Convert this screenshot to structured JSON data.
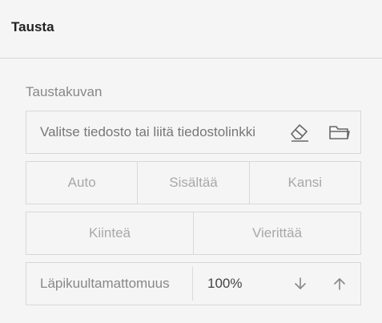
{
  "panel": {
    "title": "Tausta"
  },
  "background_image": {
    "label": "Taustakuvan",
    "file_input": {
      "placeholder": "Valitse tiedosto tai liitä tiedostolinkki",
      "value": ""
    },
    "icons": {
      "clear": "eraser-icon",
      "browse": "folder-icon"
    }
  },
  "size_options": [
    "Auto",
    "Sisältää",
    "Kansi"
  ],
  "attachment_options": [
    "Kiinteä",
    "Vierittää"
  ],
  "opacity": {
    "label": "Läpikuultamattomuus",
    "value": "100%",
    "icons": {
      "decrease": "arrow-down-icon",
      "increase": "arrow-up-icon"
    }
  },
  "colors": {
    "background": "#f5f5f5",
    "border": "#d9d9d9",
    "muted_text": "#a8a8a8",
    "icon": "#666666"
  }
}
